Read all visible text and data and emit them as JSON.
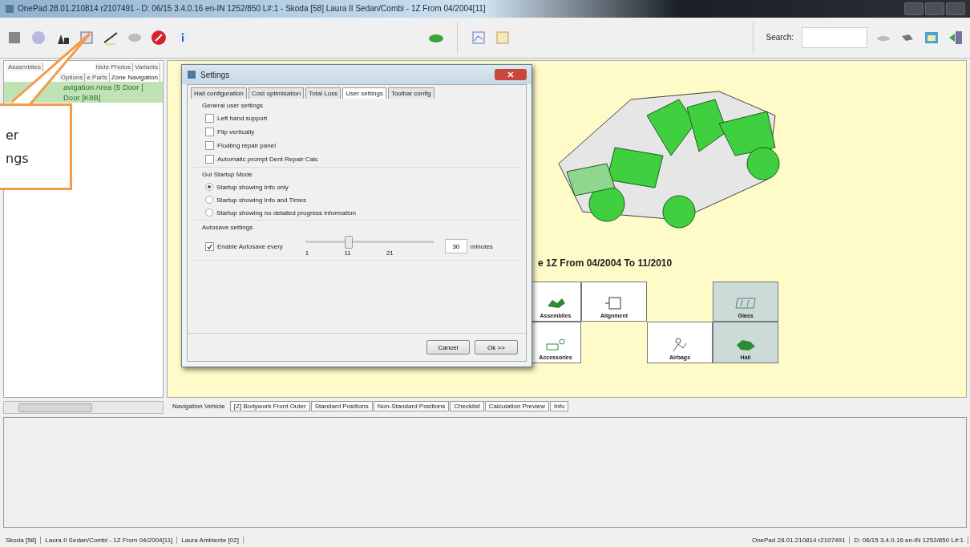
{
  "window": {
    "title": "OnePad 28.01.210814 r2107491 - D: 06/15 3.4.0.16 en-IN 1252/850 L#:1 - Skoda [58] Laura II Sedan/Combi - 1Z From 04/2004[11]"
  },
  "toolbar": {
    "search": {
      "label": "Search:"
    }
  },
  "left_panel": {
    "tabs": [
      {
        "label": "Assemblies",
        "selected": false
      },
      {
        "label": "hicle Photos",
        "selected": false
      },
      {
        "label": "Variants",
        "selected": false
      },
      {
        "label": "Options",
        "selected": false
      },
      {
        "label": "e Parts",
        "selected": false
      },
      {
        "label": "Zone Navigation",
        "selected": true
      }
    ],
    "tree": [
      {
        "label": "avigation Area (5 Door [",
        "selected": true
      },
      {
        "label": "Door [K8B]",
        "selected": true
      }
    ]
  },
  "view": {
    "heading": "e 1Z From 04/2004 To 11/2010",
    "tiles": [
      {
        "label": "Assemblies",
        "selected": false
      },
      {
        "label": "Alignment",
        "selected": false
      },
      {
        "label": "Glass",
        "selected": true
      },
      {
        "label": "Accessories",
        "selected": false
      },
      {
        "label": "Airbags",
        "selected": false
      },
      {
        "label": "Hail",
        "selected": true
      }
    ],
    "tabs": [
      {
        "label": "Navigation Vehicle",
        "selected": true
      },
      {
        "label": "[Z] Bodywork Front Outer",
        "selected": false
      },
      {
        "label": "Standard Positions",
        "selected": false
      },
      {
        "label": "Non-Standard Positions",
        "selected": false
      },
      {
        "label": "Checklist",
        "selected": false
      },
      {
        "label": "Calculation Preview",
        "selected": false
      },
      {
        "label": "Info",
        "selected": false
      }
    ]
  },
  "dialog": {
    "title": "Settings",
    "tabs": [
      {
        "label": "Hail configuration",
        "selected": false
      },
      {
        "label": "Cost optimisation",
        "selected": false
      },
      {
        "label": "Total Loss",
        "selected": false
      },
      {
        "label": "User settings",
        "selected": true
      },
      {
        "label": "Toolbar config",
        "selected": false
      }
    ],
    "general": {
      "heading": "General user settings",
      "options": [
        {
          "label": "Left hand support",
          "checked": false
        },
        {
          "label": "Flip vertically",
          "checked": false
        },
        {
          "label": "Floating repair panel",
          "checked": false
        },
        {
          "label": "Automatic prompt Dent Repair Calc",
          "checked": false
        }
      ]
    },
    "startup": {
      "heading": "Gui Startup Mode",
      "options": [
        {
          "label": "Startup showing Info only",
          "selected": true
        },
        {
          "label": "Startup showing Info and Times",
          "selected": false
        },
        {
          "label": "Startup showing no detailed progress information",
          "selected": false
        }
      ]
    },
    "autosave": {
      "heading": "Autosave settings",
      "enable": {
        "label": "Enable Autosave every",
        "checked": true
      },
      "slider": {
        "level": 0.33,
        "ticks": [
          "1",
          "11",
          "21"
        ]
      },
      "value": "30",
      "unit": "minutes"
    },
    "buttons": [
      "Cancel",
      "Ok >>"
    ]
  },
  "callout": {
    "lines": [
      "er",
      "ngs"
    ]
  },
  "status_bar": {
    "left": [
      "Skoda [58]",
      "Laura II Sedan/Combi - 1Z From 04/2004[11]",
      "Laura Ambiente [02]"
    ],
    "right": [
      "OnePad 28.01.210814 r2107491",
      "D: 06/15 3.4.0.16 en-IN 1252/850 L#:1"
    ]
  }
}
